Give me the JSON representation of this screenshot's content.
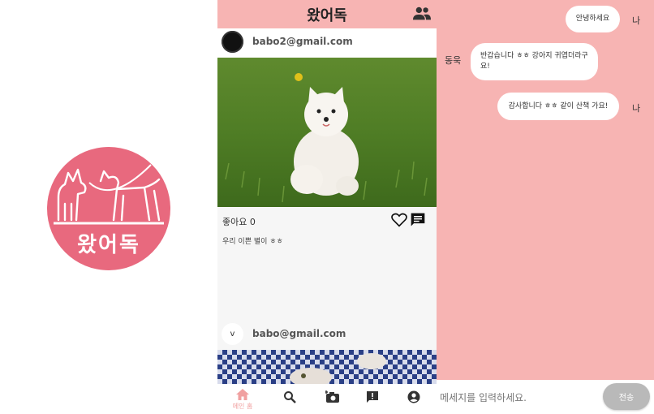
{
  "logo": {
    "text": "왔어독",
    "background_color": "#e8697e",
    "icon": "dogs-walking-logo"
  },
  "feed": {
    "header": {
      "title": "왔어독",
      "background_color": "#f7b4b3",
      "friends_icon": "people-icon"
    },
    "posts": [
      {
        "email": "babo2@gmail.com",
        "image": "white-pomeranian-on-grass",
        "likes_label": "좋아요 0",
        "caption": "우리 이쁜 별이 ㅎㅎ",
        "heart_icon": "heart-outline-icon",
        "comment_icon": "chat-bubble-icon"
      },
      {
        "email": "babo@gmail.com",
        "avatar_letter": "v",
        "image": "dog-on-checkered-blanket"
      }
    ],
    "bottom_nav": {
      "items": [
        {
          "icon": "home-icon",
          "label": "메인 홈",
          "active": true
        },
        {
          "icon": "search-icon"
        },
        {
          "icon": "add-photo-icon"
        },
        {
          "icon": "report-icon"
        },
        {
          "icon": "profile-icon"
        }
      ],
      "active_color": "#f0a0a0"
    }
  },
  "chat": {
    "background_color": "#f7b4b3",
    "messages": [
      {
        "sender": "나",
        "text": "안녕하세요",
        "side": "right"
      },
      {
        "sender": "동욱",
        "text": "반갑습니다 ㅎㅎ 강아지 귀엽더라구요!",
        "side": "left"
      },
      {
        "sender": "나",
        "text": "감사합니다 ㅎㅎ 같이 산책 가요!",
        "side": "right"
      }
    ],
    "input_placeholder": "메세지를 입력하세요.",
    "send_label": "전송"
  }
}
